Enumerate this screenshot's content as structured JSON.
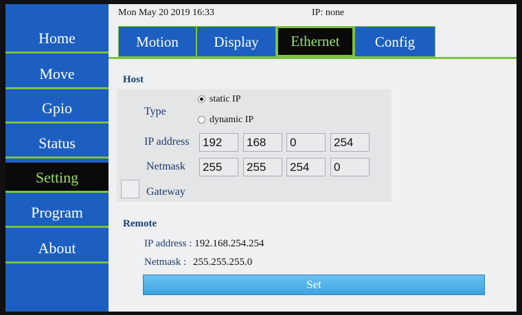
{
  "sidebar": {
    "items": [
      {
        "label": "Home"
      },
      {
        "label": "Move"
      },
      {
        "label": "Gpio"
      },
      {
        "label": "Status"
      },
      {
        "label": "Setting"
      },
      {
        "label": "Program"
      },
      {
        "label": "About"
      }
    ],
    "active": "Setting"
  },
  "topbar": {
    "datetime": "Mon May 20 2019 16:33",
    "ip": "IP: none"
  },
  "tabs": [
    {
      "label": "Motion"
    },
    {
      "label": "Display"
    },
    {
      "label": "Ethernet"
    },
    {
      "label": "Config"
    }
  ],
  "active_tab": "Ethernet",
  "host": {
    "title": "Host",
    "type_label": "Type",
    "static_label": "static IP",
    "dynamic_label": "dynamic IP",
    "selected": "static IP",
    "ip_label": "IP address",
    "ip": [
      "192",
      "168",
      "0",
      "254"
    ],
    "netmask_label": "Netmask",
    "netmask": [
      "255",
      "255",
      "254",
      "0"
    ],
    "gateway_label": "Gateway",
    "gateway_checked": false
  },
  "remote": {
    "title": "Remote",
    "ip_label": "IP address :",
    "ip_value": "192.168.254.254",
    "netmask_label": "Netmask :",
    "netmask_value": "255.255.255.0"
  },
  "set_label": "Set",
  "colors": {
    "accent": "#1c5fc0",
    "highlight": "#7cc142",
    "active_bg": "#0a0a0a"
  }
}
